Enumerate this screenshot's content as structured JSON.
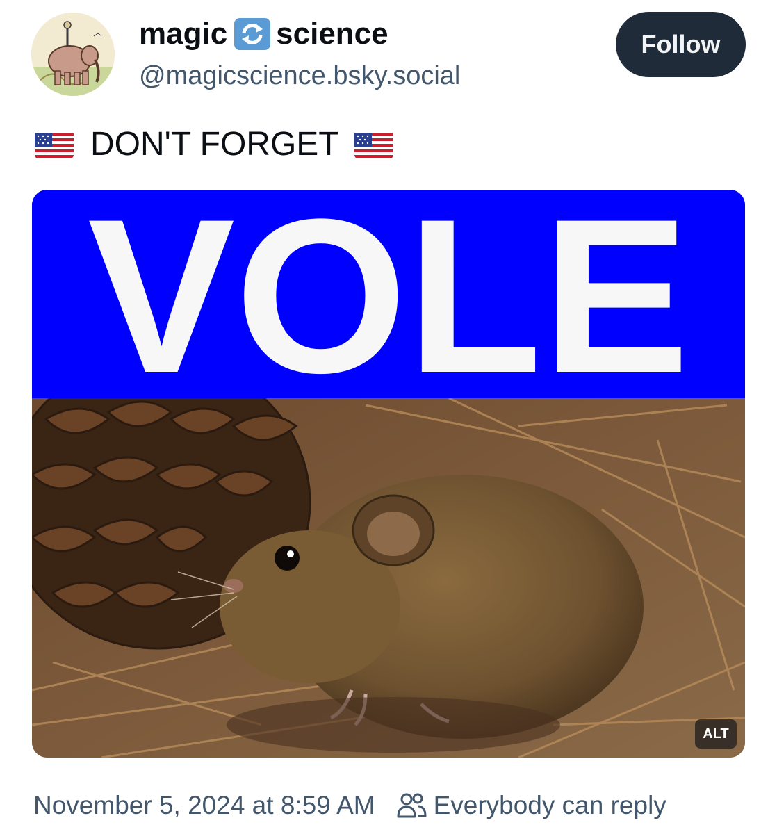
{
  "profile": {
    "display_name_left": "magic",
    "display_name_emoji": "counterclockwise-arrows-emoji",
    "display_name_right": "science",
    "handle": "@magicscience.bsky.social",
    "avatar": "cartoon-elephant-avatar"
  },
  "follow_button": {
    "label": "Follow"
  },
  "post": {
    "flag_icon": "us-flag-emoji",
    "text": "DON'T FORGET"
  },
  "media": {
    "banner_text": "VOLE",
    "banner_color": "#0000ff",
    "photo": "vole-beside-pinecone-photo",
    "alt_badge": "ALT"
  },
  "footer": {
    "timestamp": "November 5, 2024 at 8:59 AM",
    "reply_icon": "people-icon",
    "reply_setting": "Everybody can reply"
  },
  "colors": {
    "text": "#0b0f14",
    "muted": "#42576c",
    "button": "#1f2b38"
  }
}
